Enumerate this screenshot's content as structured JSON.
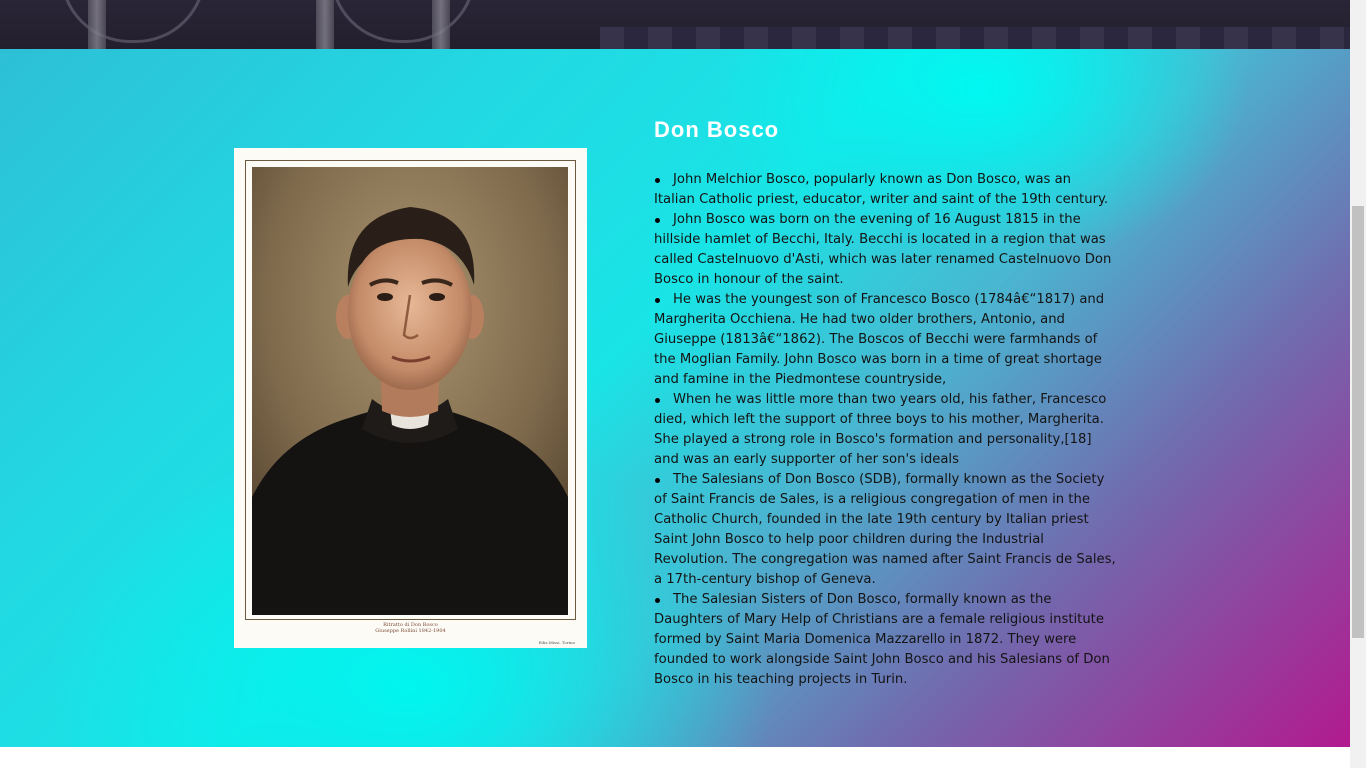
{
  "section": {
    "title": "Don Bosco",
    "facts": [
      "John Melchior Bosco, popularly known as Don Bosco, was an Italian Catholic priest, educator, writer and saint of the 19th century.",
      "John Bosco was born on the evening of 16 August 1815 in the hillside hamlet of Becchi, Italy. Becchi is located in a region that was called Castelnuovo d'Asti, which was later renamed Castelnuovo Don Bosco in honour of the saint.",
      "He was the youngest son of Francesco Bosco (1784â€“1817) and Margherita Occhiena. He had two older brothers, Antonio, and Giuseppe (1813â€“1862). The Boscos of Becchi were farmhands of the Moglian Family. John Bosco was born in a time of great shortage and famine in the Piedmontese countryside,",
      "When he was little more than two years old, his father, Francesco died, which left the support of three boys to his mother, Margherita. She played a strong role in Bosco's formation and personality,[18] and was an early supporter of her son's ideals",
      "The Salesians of Don Bosco (SDB), formally known as the Society of Saint Francis de Sales, is a religious congregation of men in the Catholic Church, founded in the late 19th century by Italian priest Saint John Bosco to help poor children during the Industrial Revolution. The congregation was named after Saint Francis de Sales, a 17th-century bishop of Geneva.",
      "The Salesian Sisters of Don Bosco, formally known as the Daughters of Mary Help of Christians are a female religious institute formed by Saint Maria Domenica Mazzarello in 1872. They were founded to work alongside Saint John Bosco and his Salesians of Don Bosco in his teaching projects in Turin."
    ]
  },
  "portrait": {
    "caption_line1": "Ritratto di Don Bosco",
    "caption_line2": "Giuseppe Rollini 1842-1904",
    "credit": "Ediz.Missi. Torino"
  },
  "colors": {
    "gradient_cyan": "#00f6ef",
    "gradient_magenta": "#b21a8f",
    "title_color": "#ffffff",
    "text_color": "#141414"
  }
}
